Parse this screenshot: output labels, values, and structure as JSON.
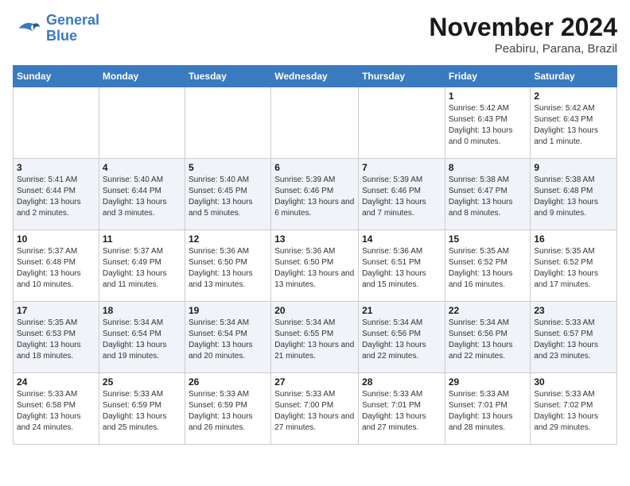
{
  "logo": {
    "line1": "General",
    "line2": "Blue"
  },
  "title": "November 2024",
  "location": "Peabiru, Parana, Brazil",
  "weekdays": [
    "Sunday",
    "Monday",
    "Tuesday",
    "Wednesday",
    "Thursday",
    "Friday",
    "Saturday"
  ],
  "weeks": [
    [
      {
        "day": "",
        "info": ""
      },
      {
        "day": "",
        "info": ""
      },
      {
        "day": "",
        "info": ""
      },
      {
        "day": "",
        "info": ""
      },
      {
        "day": "",
        "info": ""
      },
      {
        "day": "1",
        "info": "Sunrise: 5:42 AM\nSunset: 6:43 PM\nDaylight: 13 hours and 0 minutes."
      },
      {
        "day": "2",
        "info": "Sunrise: 5:42 AM\nSunset: 6:43 PM\nDaylight: 13 hours and 1 minute."
      }
    ],
    [
      {
        "day": "3",
        "info": "Sunrise: 5:41 AM\nSunset: 6:44 PM\nDaylight: 13 hours and 2 minutes."
      },
      {
        "day": "4",
        "info": "Sunrise: 5:40 AM\nSunset: 6:44 PM\nDaylight: 13 hours and 3 minutes."
      },
      {
        "day": "5",
        "info": "Sunrise: 5:40 AM\nSunset: 6:45 PM\nDaylight: 13 hours and 5 minutes."
      },
      {
        "day": "6",
        "info": "Sunrise: 5:39 AM\nSunset: 6:46 PM\nDaylight: 13 hours and 6 minutes."
      },
      {
        "day": "7",
        "info": "Sunrise: 5:39 AM\nSunset: 6:46 PM\nDaylight: 13 hours and 7 minutes."
      },
      {
        "day": "8",
        "info": "Sunrise: 5:38 AM\nSunset: 6:47 PM\nDaylight: 13 hours and 8 minutes."
      },
      {
        "day": "9",
        "info": "Sunrise: 5:38 AM\nSunset: 6:48 PM\nDaylight: 13 hours and 9 minutes."
      }
    ],
    [
      {
        "day": "10",
        "info": "Sunrise: 5:37 AM\nSunset: 6:48 PM\nDaylight: 13 hours and 10 minutes."
      },
      {
        "day": "11",
        "info": "Sunrise: 5:37 AM\nSunset: 6:49 PM\nDaylight: 13 hours and 11 minutes."
      },
      {
        "day": "12",
        "info": "Sunrise: 5:36 AM\nSunset: 6:50 PM\nDaylight: 13 hours and 13 minutes."
      },
      {
        "day": "13",
        "info": "Sunrise: 5:36 AM\nSunset: 6:50 PM\nDaylight: 13 hours and 13 minutes."
      },
      {
        "day": "14",
        "info": "Sunrise: 5:36 AM\nSunset: 6:51 PM\nDaylight: 13 hours and 15 minutes."
      },
      {
        "day": "15",
        "info": "Sunrise: 5:35 AM\nSunset: 6:52 PM\nDaylight: 13 hours and 16 minutes."
      },
      {
        "day": "16",
        "info": "Sunrise: 5:35 AM\nSunset: 6:52 PM\nDaylight: 13 hours and 17 minutes."
      }
    ],
    [
      {
        "day": "17",
        "info": "Sunrise: 5:35 AM\nSunset: 6:53 PM\nDaylight: 13 hours and 18 minutes."
      },
      {
        "day": "18",
        "info": "Sunrise: 5:34 AM\nSunset: 6:54 PM\nDaylight: 13 hours and 19 minutes."
      },
      {
        "day": "19",
        "info": "Sunrise: 5:34 AM\nSunset: 6:54 PM\nDaylight: 13 hours and 20 minutes."
      },
      {
        "day": "20",
        "info": "Sunrise: 5:34 AM\nSunset: 6:55 PM\nDaylight: 13 hours and 21 minutes."
      },
      {
        "day": "21",
        "info": "Sunrise: 5:34 AM\nSunset: 6:56 PM\nDaylight: 13 hours and 22 minutes."
      },
      {
        "day": "22",
        "info": "Sunrise: 5:34 AM\nSunset: 6:56 PM\nDaylight: 13 hours and 22 minutes."
      },
      {
        "day": "23",
        "info": "Sunrise: 5:33 AM\nSunset: 6:57 PM\nDaylight: 13 hours and 23 minutes."
      }
    ],
    [
      {
        "day": "24",
        "info": "Sunrise: 5:33 AM\nSunset: 6:58 PM\nDaylight: 13 hours and 24 minutes."
      },
      {
        "day": "25",
        "info": "Sunrise: 5:33 AM\nSunset: 6:59 PM\nDaylight: 13 hours and 25 minutes."
      },
      {
        "day": "26",
        "info": "Sunrise: 5:33 AM\nSunset: 6:59 PM\nDaylight: 13 hours and 26 minutes."
      },
      {
        "day": "27",
        "info": "Sunrise: 5:33 AM\nSunset: 7:00 PM\nDaylight: 13 hours and 27 minutes."
      },
      {
        "day": "28",
        "info": "Sunrise: 5:33 AM\nSunset: 7:01 PM\nDaylight: 13 hours and 27 minutes."
      },
      {
        "day": "29",
        "info": "Sunrise: 5:33 AM\nSunset: 7:01 PM\nDaylight: 13 hours and 28 minutes."
      },
      {
        "day": "30",
        "info": "Sunrise: 5:33 AM\nSunset: 7:02 PM\nDaylight: 13 hours and 29 minutes."
      }
    ]
  ]
}
